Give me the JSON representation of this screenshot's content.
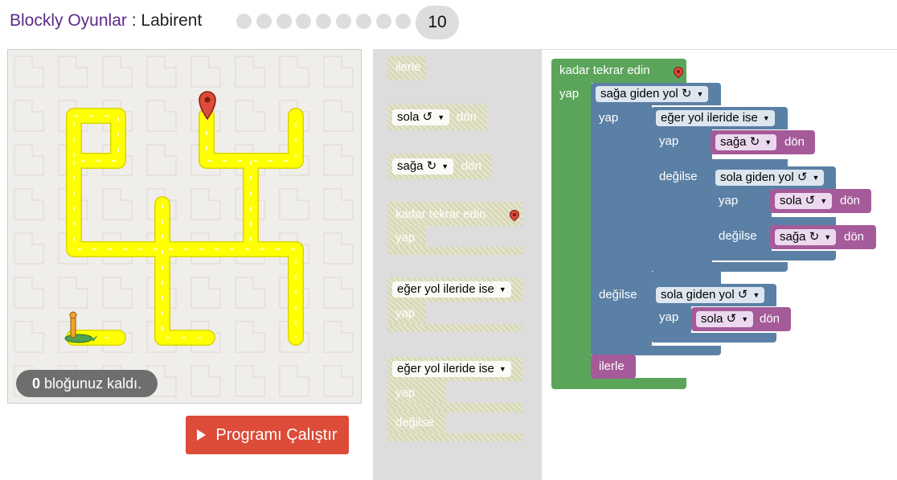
{
  "header": {
    "app_name": "Blockly Oyunlar",
    "separator": " : ",
    "game_name": "Labirent",
    "levels": [
      "1",
      "2",
      "3",
      "4",
      "5",
      "6",
      "7",
      "8",
      "9",
      "10"
    ],
    "current_level": "10"
  },
  "maze": {
    "blocks_left_count": "0",
    "blocks_left_text": " bloğunuz kaldı."
  },
  "run_button": {
    "label": "Programı Çalıştır"
  },
  "toolbox": {
    "move_forward": "ilerle",
    "turn_left_dir": "sola ↺",
    "turn_left_text": "dön",
    "turn_right_dir": "sağa ↻",
    "turn_right_text": "dön",
    "repeat_label": "kadar tekrar edin",
    "repeat_do": "yap",
    "if_label": "eğer yol ileride ise",
    "if_do": "yap",
    "ifelse_label": "eğer yol ileride ise",
    "ifelse_do": "yap",
    "ifelse_else": "değilse"
  },
  "program": {
    "repeat_label": "kadar tekrar edin",
    "repeat_do": "yap",
    "if_right_path": "sağa giden yol ↻",
    "if_right_do": "yap",
    "if_ahead_path": "eğer yol ileride ise",
    "if_ahead_do": "yap",
    "turn_right_dir": "sağa ↻",
    "turn_right_text": "dön",
    "if_ahead_else": "değilse",
    "if_left_path": "sola giden yol ↺",
    "if_left_do": "yap",
    "turn_left_dir": "sola ↺",
    "turn_left_text": "dön",
    "if_left_else": "değilse",
    "turn_right2_dir": "sağa ↻",
    "turn_right2_text": "dön",
    "outer_else": "değilse",
    "outer_left_path": "sola giden yol ↺",
    "outer_left_do": "yap",
    "outer_turn_left_dir": "sola ↺",
    "outer_turn_left_text": "dön",
    "move_forward": "ilerle"
  },
  "colors": {
    "loop_green": "#5ba55b",
    "logic_blue": "#5b80a5",
    "action_purple": "#a55b99",
    "maze_path": "#ffff00",
    "run_button": "#dd4b39",
    "toolbox_bg": "#dddddd"
  },
  "icons": [
    "play-icon",
    "marker-icon",
    "pegman-icon",
    "dropdown-arrow-icon"
  ]
}
